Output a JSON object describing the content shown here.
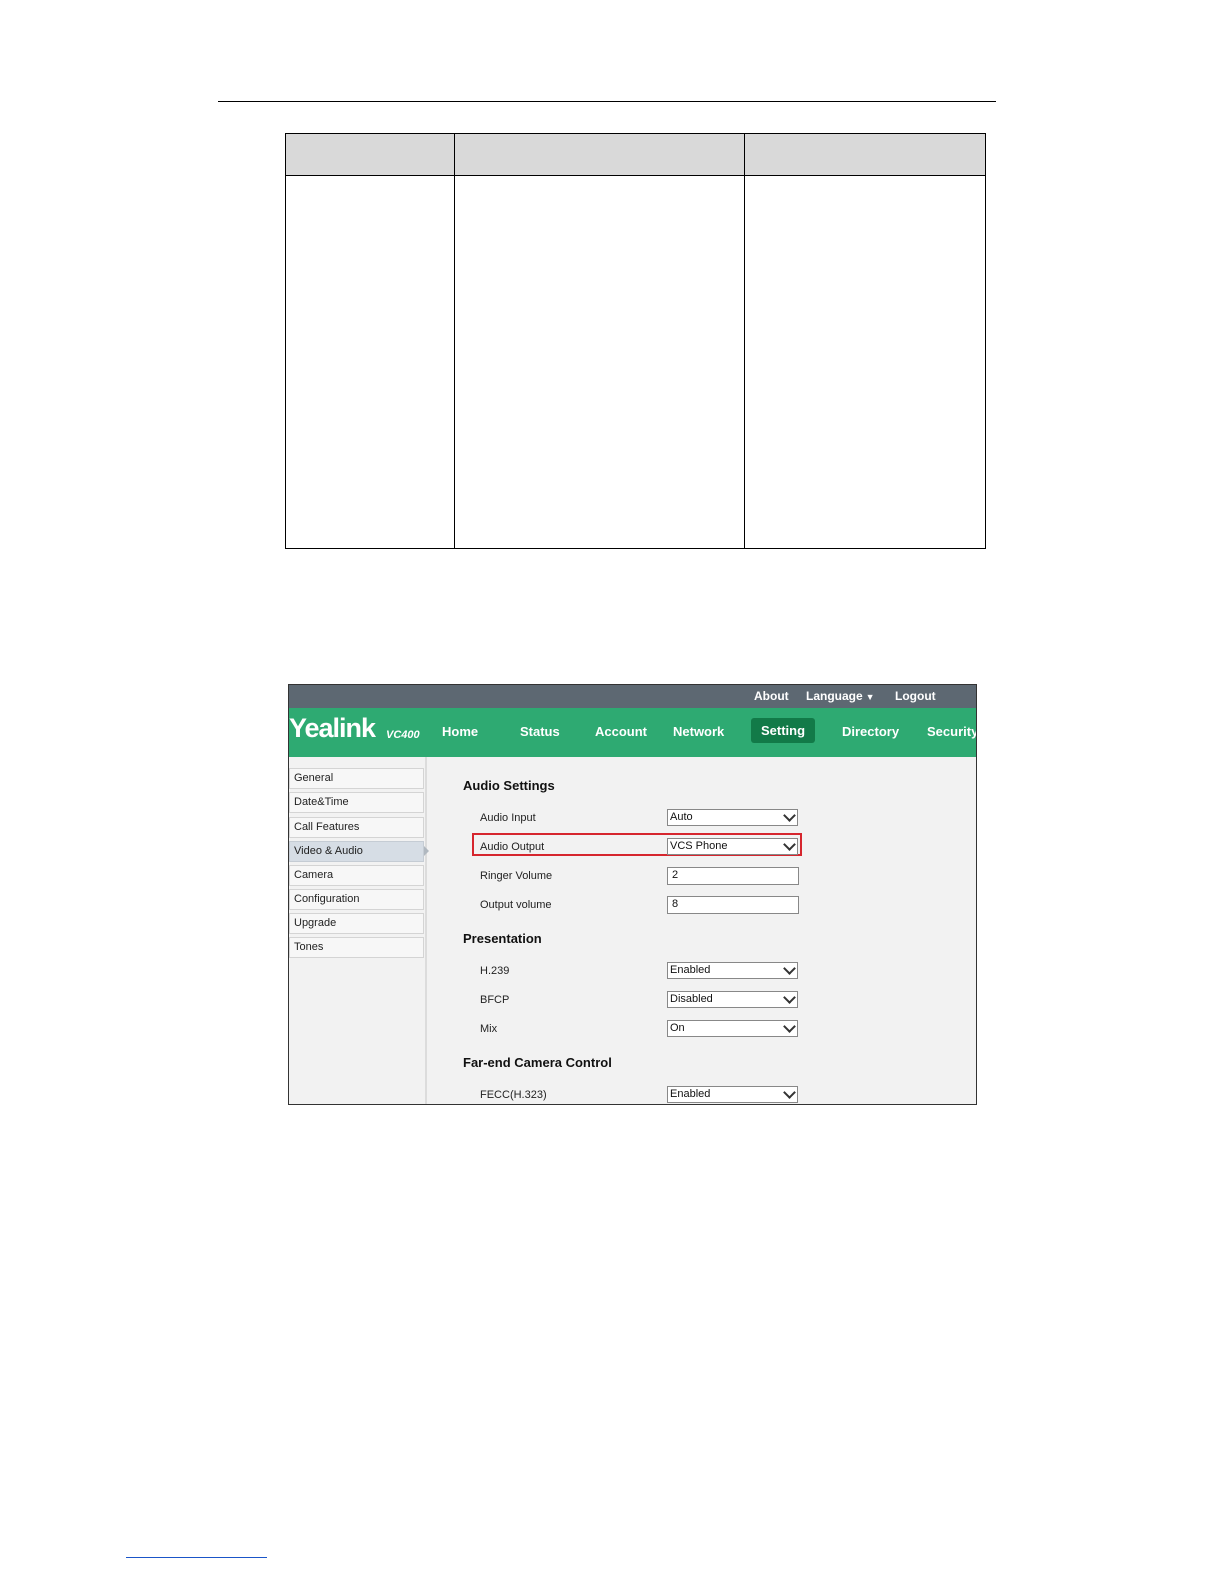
{
  "util": {
    "about": "About",
    "language": "Language",
    "logout": "Logout"
  },
  "brand": {
    "logo": "Yealink",
    "model": "VC400"
  },
  "nav": [
    "Home",
    "Status",
    "Account",
    "Network",
    "Setting",
    "Directory",
    "Security"
  ],
  "nav_active": "Setting",
  "sidebar": [
    "General",
    "Date&Time",
    "Call Features",
    "Video & Audio",
    "Camera",
    "Configuration",
    "Upgrade",
    "Tones"
  ],
  "sidebar_active": "Video & Audio",
  "audio_settings": {
    "title": "Audio Settings",
    "audio_input_label": "Audio Input",
    "audio_input_value": "Auto",
    "audio_output_label": "Audio Output",
    "audio_output_value": "VCS Phone",
    "ringer_volume_label": "Ringer Volume",
    "ringer_volume_value": "2",
    "output_volume_label": "Output volume",
    "output_volume_value": "8"
  },
  "presentation": {
    "title": "Presentation",
    "h239_label": "H.239",
    "h239_value": "Enabled",
    "bfcp_label": "BFCP",
    "bfcp_value": "Disabled",
    "mix_label": "Mix",
    "mix_value": "On"
  },
  "fecc": {
    "title": "Far-end Camera Control",
    "fecc_label": "FECC(H.323)",
    "fecc_value": "Enabled"
  }
}
